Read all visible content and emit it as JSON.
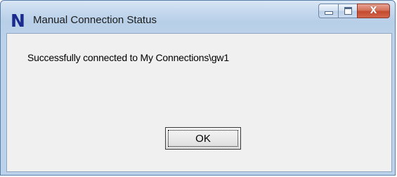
{
  "window": {
    "title": "Manual Connection Status",
    "app_icon_glyph": "N",
    "app_icon_name": "app-logo-icon",
    "accent_color": "#1a2a8e"
  },
  "caption_buttons": {
    "minimize_icon": "minimize-icon",
    "maximize_icon": "maximize-icon",
    "close_icon": "close-icon",
    "close_glyph": "X",
    "close_color": "#c44a2e"
  },
  "dialog": {
    "message": "Successfully connected to My Connections\\gw1",
    "ok_label": "OK"
  }
}
